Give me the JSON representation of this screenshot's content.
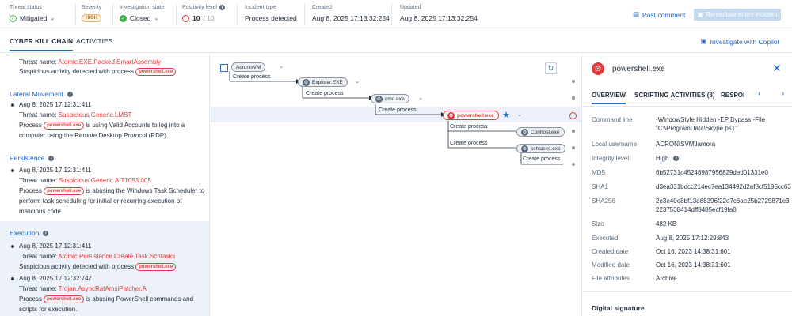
{
  "header": {
    "threat_status": {
      "label": "Threat status",
      "value": "Mitigated"
    },
    "severity": {
      "label": "Severity",
      "value": "HIGH"
    },
    "investigation_state": {
      "label": "Investigation state",
      "value": "Closed"
    },
    "positivity": {
      "label": "Positivity level",
      "value": "10",
      "max": "/ 10"
    },
    "incident_type": {
      "label": "Incident type",
      "value": "Process detected"
    },
    "created": {
      "label": "Created",
      "value": "Aug 8, 2025 17:13:32:254"
    },
    "updated": {
      "label": "Updated",
      "value": "Aug 8, 2025 17:13:32:254"
    },
    "post_comment": "Post comment",
    "remediate": "Remediate entire incident",
    "colors": {
      "accent": "#2668c5",
      "danger": "#e23b3b",
      "success": "#3fae49",
      "warning": "#f0b060"
    }
  },
  "tabs": {
    "kill_chain": "CYBER KILL CHAIN",
    "activities": "ACTIVITIES",
    "copilot": "Investigate with Copilot"
  },
  "kill_chain": {
    "top": {
      "threat_name_prefix": "Threat name: ",
      "threat_name": "Atomic.EXE.Packed.SmartAssembly",
      "suspicious_prefix": "Suspicious activity detected with process",
      "process": "powershell.exe"
    },
    "lateral": {
      "title": "Lateral Movement",
      "time": "Aug 8, 2025 17:12:31:411",
      "threat_name_prefix": "Threat name: ",
      "threat_name": "Suspicious.Generic.LMST",
      "process_prefix": "Process",
      "process": "powershell.exe",
      "desc1": "is using Valid Accounts to log into a",
      "desc2": "computer using the Remote Desktop Protocol (RDP)."
    },
    "persistence": {
      "title": "Persistence",
      "time": "Aug 8, 2025 17:12:31:411",
      "threat_name_prefix": "Threat name: ",
      "threat_name": "Suspicious.Generic.A.T1053.005",
      "process_prefix": "Process",
      "process": "powershell.exe",
      "desc1": "is abusing the Windows Task Scheduler to",
      "desc2": "perform task scheduling for initial or recurring execution of",
      "desc3": "malicious code."
    },
    "execution": {
      "title": "Execution",
      "time1": "Aug 8, 2025 17:12:31:411",
      "threat_name_prefix": "Threat name: ",
      "threat_name1": "Atomic.Persistence.Create.Task.Schtasks",
      "suspicious_prefix": "Suspicious activity detected with process",
      "process": "powershell.exe",
      "time2": "Aug 8, 2025 17:12:32:747",
      "threat_name2": "Trojan.AsyncRatAmsiPatcher.A",
      "process_prefix": "Process",
      "desc1": "is abusing PowerShell commands and",
      "desc2": "scripts for execution."
    }
  },
  "graph": {
    "nodes": {
      "acronis": "AcronisVM",
      "explorer": "Explorer.EXE",
      "cmd": "cmd.exe",
      "powershell": "powershell.exe",
      "conhost": "Conhost.exe",
      "schtasks": "schtasks.exe"
    },
    "edge_label": "Create process"
  },
  "details": {
    "title": "powershell.exe",
    "tabs": [
      "OVERVIEW",
      "SCRIPTING ACTIVITIES (8)",
      "RESPONSE"
    ],
    "command_line_label": "Command line",
    "command_line": "-WindowStyle Hidden -EP Bypass -File \"C:\\ProgramData\\Skype.ps1\"",
    "local_username_label": "Local username",
    "local_username": "ACRONISVM\\lamora",
    "integrity_label": "Integrity level",
    "integrity": "High",
    "md5_label": "MD5",
    "md5": "6b52731c45246987956829ded01331e0",
    "sha1_label": "SHA1",
    "sha1": "d3ea331bdcc214ec7ea134492d2af8cf5195cc63",
    "sha256_label": "SHA256",
    "sha256_1": "2e3e40e8bf13d88396f22e7c6ae25b2725871e3",
    "sha256_2": "2237538414dff8485ecf19fa0",
    "size_label": "Size",
    "size": "482 KB",
    "executed_label": "Executed",
    "executed": "Aug 8, 2025 17:12:29:843",
    "created_label": "Created date",
    "created": "Oct 16, 2023 14:38:31:601",
    "modified_label": "Modified date",
    "modified": "Oct 16, 2023 14:38:31:601",
    "attributes_label": "File attributes",
    "attributes": "Archive",
    "digital_signature": "Digital signature"
  }
}
